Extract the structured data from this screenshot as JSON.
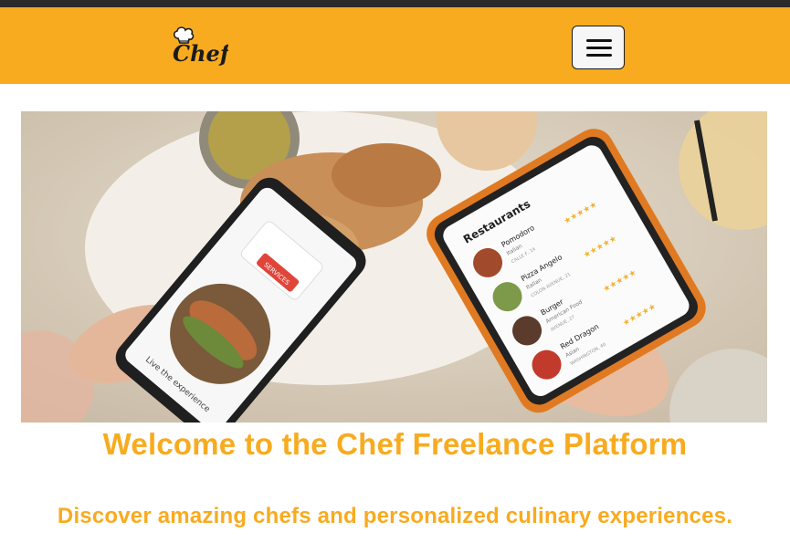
{
  "header": {
    "logo_text": "Chef",
    "brand_color": "#f8ab1e",
    "menu_icon": "hamburger-menu-icon"
  },
  "hero": {
    "image_description_icon": "hero-photo",
    "left_phone": {
      "badge_text": "SERVICES",
      "caption": "Live the experience"
    },
    "right_phone": {
      "heading": "Restaurants",
      "restaurants": [
        {
          "name": "Pomodoro",
          "cuisine": "Italian",
          "address": "CALLE F, 14"
        },
        {
          "name": "Pizza Angelo",
          "cuisine": "Italian",
          "address": "COLON AVENUE, 21"
        },
        {
          "name": "Burger",
          "cuisine": "American Food",
          "address": "AVENUE, 27"
        },
        {
          "name": "Red Dragon",
          "cuisine": "Asian",
          "address": "WASHINGTON, 40"
        }
      ]
    }
  },
  "main": {
    "title": "Welcome to the Chef Freelance Platform",
    "subtitle": "Discover amazing chefs and personalized culinary experiences."
  }
}
